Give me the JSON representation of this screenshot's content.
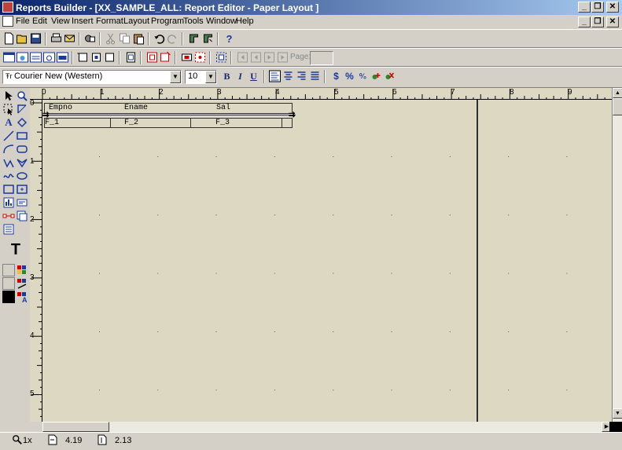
{
  "window": {
    "title": "Reports Builder - [XX_SAMPLE_ALL: Report Editor - Paper Layout ]",
    "app_icon": "reports-builder-icon"
  },
  "menu": [
    "File",
    "Edit",
    "View",
    "Insert",
    "Format",
    "Layout",
    "Program",
    "Tools",
    "Window",
    "Help"
  ],
  "toolbar_nav": {
    "page_label": "Page:",
    "page_value": ""
  },
  "font_bar": {
    "font_name": "Courier New (Western)",
    "font_size": "10",
    "bold": "B",
    "italic": "I",
    "underline": "U"
  },
  "report": {
    "headers": [
      "Empno",
      "Ename",
      "Sal"
    ],
    "fields": [
      "F_1",
      "F_2",
      "F_3"
    ]
  },
  "rulers": {
    "horizontal": [
      "0",
      "1",
      "2",
      "3",
      "4",
      "5",
      "6",
      "7",
      "8",
      "9"
    ],
    "vertical": [
      "0",
      "1",
      "2",
      "3",
      "4",
      "5"
    ]
  },
  "status": {
    "zoom": "1x",
    "x_pos": "4.19",
    "y_pos": "2.13"
  },
  "palette_text_tool": "T"
}
